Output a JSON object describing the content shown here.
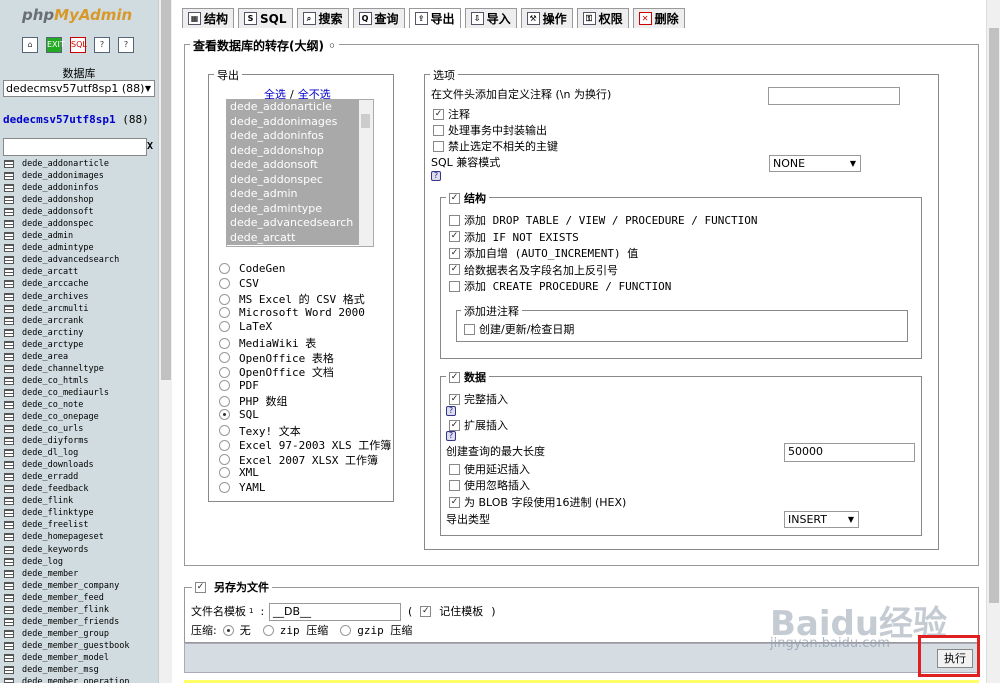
{
  "logo": {
    "prefix": "php",
    "main": "MyAdmin"
  },
  "left_icons": [
    "home-icon",
    "exit-icon",
    "sql-icon",
    "query-window-icon",
    "help-icon"
  ],
  "left_icon_glyphs": [
    "⌂",
    "EXIT",
    "SQL",
    "?",
    "?"
  ],
  "sidebar": {
    "db_label": "数据库",
    "db_select": "dedecmsv57utf8sp1 (88)",
    "db_link": "dedecmsv57utf8sp1",
    "db_count": "(88)",
    "filter_clear": "X",
    "tables": [
      "dede_addonarticle",
      "dede_addonimages",
      "dede_addoninfos",
      "dede_addonshop",
      "dede_addonsoft",
      "dede_addonspec",
      "dede_admin",
      "dede_admintype",
      "dede_advancedsearch",
      "dede_arcatt",
      "dede_arccache",
      "dede_archives",
      "dede_arcmulti",
      "dede_arcrank",
      "dede_arctiny",
      "dede_arctype",
      "dede_area",
      "dede_channeltype",
      "dede_co_htmls",
      "dede_co_mediaurls",
      "dede_co_note",
      "dede_co_onepage",
      "dede_co_urls",
      "dede_diyforms",
      "dede_dl_log",
      "dede_downloads",
      "dede_erradd",
      "dede_feedback",
      "dede_flink",
      "dede_flinktype",
      "dede_freelist",
      "dede_homepageset",
      "dede_keywords",
      "dede_log",
      "dede_member",
      "dede_member_company",
      "dede_member_feed",
      "dede_member_flink",
      "dede_member_friends",
      "dede_member_group",
      "dede_member_guestbook",
      "dede_member_model",
      "dede_member_msg",
      "dede_member_operation"
    ]
  },
  "tabs": [
    {
      "label": "结构",
      "icon": "structure-icon",
      "glyph": "▦"
    },
    {
      "label": "SQL",
      "icon": "sql-icon",
      "glyph": "S"
    },
    {
      "label": "搜索",
      "icon": "search-icon",
      "glyph": "⌕"
    },
    {
      "label": "查询",
      "icon": "query-icon",
      "glyph": "Q"
    },
    {
      "label": "导出",
      "icon": "export-icon",
      "glyph": "⇪"
    },
    {
      "label": "导入",
      "icon": "import-icon",
      "glyph": "⇩"
    },
    {
      "label": "操作",
      "icon": "operations-icon",
      "glyph": "⚒"
    },
    {
      "label": "权限",
      "icon": "privileges-icon",
      "glyph": "⚿"
    },
    {
      "label": "删除",
      "icon": "drop-icon",
      "glyph": "✕"
    }
  ],
  "main_legend": "查看数据库的转存(大纲)",
  "export": {
    "legend": "导出",
    "select_all": "全选",
    "sep": "/",
    "select_none": "全不选",
    "list": [
      "dede_addonarticle",
      "dede_addonimages",
      "dede_addoninfos",
      "dede_addonshop",
      "dede_addonsoft",
      "dede_addonspec",
      "dede_admin",
      "dede_admintype",
      "dede_advancedsearch",
      "dede_arcatt"
    ],
    "formats": [
      "CodeGen",
      "CSV",
      "MS Excel 的 CSV 格式",
      "Microsoft Word 2000",
      "LaTeX",
      "MediaWiki 表",
      "OpenOffice 表格",
      "OpenOffice 文档",
      "PDF",
      "PHP 数组",
      "SQL",
      "Texy! 文本",
      "Excel 97-2003 XLS 工作簿",
      "Excel 2007 XLSX 工作簿",
      "XML",
      "YAML"
    ],
    "selected_format": "SQL"
  },
  "options": {
    "legend": "选项",
    "header_comment_label": "在文件头添加自定义注释 (\\n 为换行)",
    "header_comment_value": "",
    "comments": "注释",
    "transaction": "处理事务中封装输出",
    "disable_fk": "禁止选定不相关的主键",
    "compat_label": "SQL 兼容模式",
    "compat_value": "NONE",
    "structure": {
      "legend": "结构",
      "items": [
        {
          "label": "添加 DROP TABLE / VIEW / PROCEDURE / FUNCTION",
          "checked": false
        },
        {
          "label": "添加 IF NOT EXISTS",
          "checked": true
        },
        {
          "label": "添加自增 (AUTO_INCREMENT) 值",
          "checked": true
        },
        {
          "label": "给数据表名及字段名加上反引号",
          "checked": true
        },
        {
          "label": "添加 CREATE PROCEDURE / FUNCTION",
          "checked": false
        }
      ],
      "comments_legend": "添加进注释",
      "comments_item": "创建/更新/检查日期"
    },
    "data": {
      "legend": "数据",
      "complete_insert": "完整插入",
      "extended_insert": "扩展插入",
      "max_query_label": "创建查询的最大长度",
      "max_query_value": "50000",
      "delayed": "使用延迟插入",
      "ignore": "使用忽略插入",
      "hex_blob": "为 BLOB 字段使用16进制 (HEX)",
      "export_type_label": "导出类型",
      "export_type_value": "INSERT"
    }
  },
  "save": {
    "legend": "另存为文件",
    "template_label": "文件名模板",
    "template_sup": "1",
    "colon": ":",
    "template_value": "__DB__",
    "paren_open": "(",
    "remember": "记住模板",
    "paren_close": ")",
    "compression_label": "压缩:",
    "none": "无",
    "zip": "zip 压缩",
    "gzip": "gzip 压缩"
  },
  "go_button": "执行",
  "watermark": {
    "main": "Baidu经验",
    "sub": "jingyan.baidu.com"
  }
}
